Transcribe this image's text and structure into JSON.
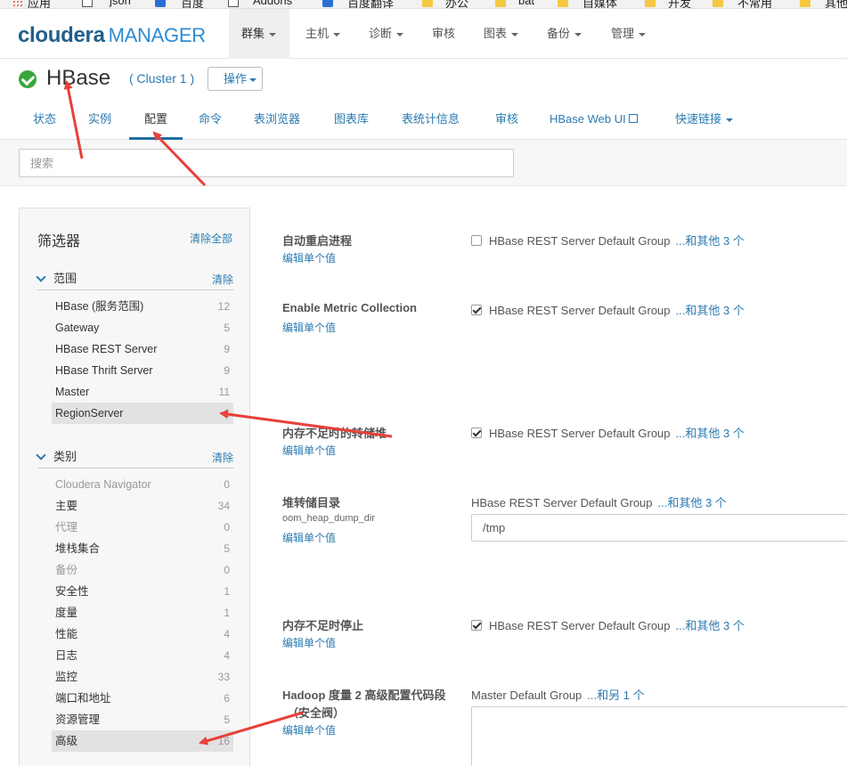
{
  "bookmarks": [
    {
      "icon": "apps-icon",
      "label": "应用"
    },
    {
      "icon": "page-icon",
      "label": "json"
    },
    {
      "icon": "baidu-icon",
      "label": "百度"
    },
    {
      "icon": "page-icon",
      "label": "Addons"
    },
    {
      "icon": "translate-icon",
      "label": "百度翻译"
    },
    {
      "icon": "folder-icon",
      "label": "办公"
    },
    {
      "icon": "folder-icon",
      "label": "bat"
    },
    {
      "icon": "folder-icon",
      "label": "自媒体"
    },
    {
      "icon": "folder-icon",
      "label": "开发"
    },
    {
      "icon": "folder-icon",
      "label": "不常用"
    },
    {
      "icon": "folder-icon",
      "label": "其他"
    }
  ],
  "logo": {
    "brand": "cloudera",
    "product": "MANAGER"
  },
  "topnav": [
    {
      "label": "群集",
      "active": true
    },
    {
      "label": "主机"
    },
    {
      "label": "诊断"
    },
    {
      "label": "审核"
    },
    {
      "label": "图表"
    },
    {
      "label": "备份"
    },
    {
      "label": "管理"
    }
  ],
  "service": {
    "name": "HBase",
    "cluster": "( Cluster 1 )",
    "ops_label": "操作",
    "status_color": "#3aa53a"
  },
  "subnav": [
    {
      "label": "状态"
    },
    {
      "label": "实例"
    },
    {
      "label": "配置",
      "active": true
    },
    {
      "label": "命令"
    },
    {
      "label": "表浏览器"
    },
    {
      "label": "图表库"
    },
    {
      "label": "表统计信息"
    },
    {
      "label": "审核"
    },
    {
      "label": "HBase Web UI"
    },
    {
      "label": "快速链接"
    }
  ],
  "search": {
    "placeholder": "搜索",
    "value": ""
  },
  "filter": {
    "title": "筛选器",
    "clear_all": "清除全部",
    "scope": {
      "label": "范围",
      "clear": "清除",
      "items": [
        {
          "label": "HBase (服务范围)",
          "count": "12"
        },
        {
          "label": "Gateway",
          "count": "5"
        },
        {
          "label": "HBase REST Server",
          "count": "9"
        },
        {
          "label": "HBase Thrift Server",
          "count": "9"
        },
        {
          "label": "Master",
          "count": "11"
        },
        {
          "label": "RegionServer",
          "count": "1"
        }
      ]
    },
    "category": {
      "label": "类别",
      "clear": "清除",
      "items": [
        {
          "label": "Cloudera Navigator",
          "count": "0"
        },
        {
          "label": "主要",
          "count": "34"
        },
        {
          "label": "代理",
          "count": "0"
        },
        {
          "label": "堆栈集合",
          "count": "5"
        },
        {
          "label": "备份",
          "count": "0"
        },
        {
          "label": "安全性",
          "count": "1"
        },
        {
          "label": "度量",
          "count": "1"
        },
        {
          "label": "性能",
          "count": "4"
        },
        {
          "label": "日志",
          "count": "4"
        },
        {
          "label": "监控",
          "count": "33"
        },
        {
          "label": "端口和地址",
          "count": "6"
        },
        {
          "label": "资源管理",
          "count": "5"
        },
        {
          "label": "高级",
          "count": "16"
        }
      ]
    }
  },
  "settings": [
    {
      "name": "自动重启进程",
      "edit": "编辑单个值",
      "checked": false,
      "group": "HBase REST Server Default Group",
      "more": "...和其他 3 个"
    },
    {
      "name": "Enable Metric Collection",
      "edit": "编辑单个值",
      "checked": true,
      "group": "HBase REST Server Default Group",
      "more": "...和其他 3 个"
    },
    {
      "name": "内存不足时的转储堆",
      "edit": "编辑单个值",
      "checked": true,
      "group": "HBase REST Server Default Group",
      "more": "...和其他 3 个"
    },
    {
      "name": "堆转储目录",
      "key": "oom_heap_dump_dir",
      "edit": "编辑单个值",
      "group": "HBase REST Server Default Group",
      "more": "...和其他 3 个",
      "value": "/tmp"
    },
    {
      "name": "内存不足时停止",
      "edit": "编辑单个值",
      "checked": true,
      "group": "HBase REST Server Default Group",
      "more": "...和其他 3 个"
    },
    {
      "name": "Hadoop 度量 2 高级配置代码段",
      "name2": "（安全阀）",
      "edit": "编辑单个值",
      "group": "Master Default Group",
      "more": "...和另 1 个",
      "value": ""
    }
  ],
  "colors": {
    "accent": "#2a7ab0",
    "brand": "#1f5f8b",
    "annotation": "#e8403a"
  }
}
